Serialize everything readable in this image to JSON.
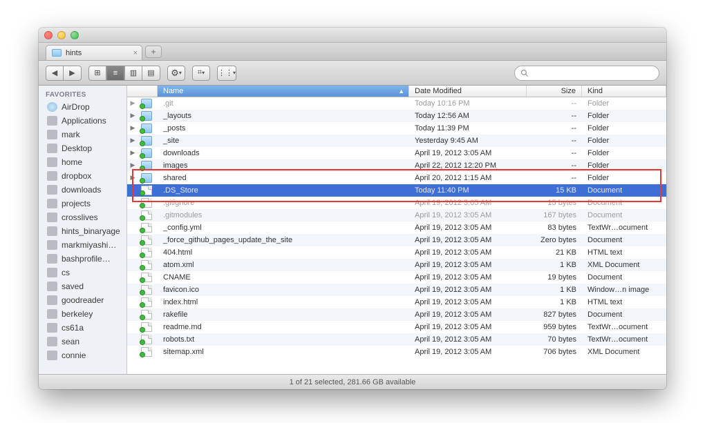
{
  "window": {
    "tab_title": "hints"
  },
  "toolbar": {
    "search_placeholder": ""
  },
  "sidebar": {
    "heading": "FAVORITES",
    "items": [
      {
        "label": "AirDrop",
        "icon": "airdrop"
      },
      {
        "label": "Applications",
        "icon": "apps"
      },
      {
        "label": "mark",
        "icon": "home"
      },
      {
        "label": "Desktop",
        "icon": "desktop"
      },
      {
        "label": "home",
        "icon": "folder"
      },
      {
        "label": "dropbox",
        "icon": "folder"
      },
      {
        "label": "downloads",
        "icon": "folder"
      },
      {
        "label": "projects",
        "icon": "folder"
      },
      {
        "label": "crosslives",
        "icon": "folder"
      },
      {
        "label": "hints_binaryage",
        "icon": "folder"
      },
      {
        "label": "markmiyashi…",
        "icon": "folder"
      },
      {
        "label": "bashprofile…",
        "icon": "folder"
      },
      {
        "label": "cs",
        "icon": "folder"
      },
      {
        "label": "saved",
        "icon": "folder"
      },
      {
        "label": "goodreader",
        "icon": "folder"
      },
      {
        "label": "berkeley",
        "icon": "folder"
      },
      {
        "label": "cs61a",
        "icon": "folder"
      },
      {
        "label": "sean",
        "icon": "folder"
      },
      {
        "label": "connie",
        "icon": "folder"
      }
    ]
  },
  "columns": {
    "name": "Name",
    "date": "Date Modified",
    "size": "Size",
    "kind": "Kind"
  },
  "files": [
    {
      "name": ".git",
      "date": "Today 10:16 PM",
      "size": "--",
      "kind": "Folder",
      "type": "folder",
      "expandable": true,
      "dim": true
    },
    {
      "name": "_layouts",
      "date": "Today 12:56 AM",
      "size": "--",
      "kind": "Folder",
      "type": "folder",
      "expandable": true
    },
    {
      "name": "_posts",
      "date": "Today 11:39 PM",
      "size": "--",
      "kind": "Folder",
      "type": "folder",
      "expandable": true
    },
    {
      "name": "_site",
      "date": "Yesterday 9:45 AM",
      "size": "--",
      "kind": "Folder",
      "type": "folder",
      "expandable": true
    },
    {
      "name": "downloads",
      "date": "April 19, 2012 3:05 AM",
      "size": "--",
      "kind": "Folder",
      "type": "folder",
      "expandable": true
    },
    {
      "name": "images",
      "date": "April 22, 2012 12:20 PM",
      "size": "--",
      "kind": "Folder",
      "type": "folder",
      "expandable": true
    },
    {
      "name": "shared",
      "date": "April 20, 2012 1:15 AM",
      "size": "--",
      "kind": "Folder",
      "type": "folder",
      "expandable": true
    },
    {
      "name": ".DS_Store",
      "date": "Today 11:40 PM",
      "size": "15 KB",
      "kind": "Document",
      "type": "doc",
      "dim": true,
      "selected": true
    },
    {
      "name": ".gitignore",
      "date": "April 19, 2012 3:05 AM",
      "size": "15 bytes",
      "kind": "Document",
      "type": "doc",
      "dim": true
    },
    {
      "name": ".gitmodules",
      "date": "April 19, 2012 3:05 AM",
      "size": "167 bytes",
      "kind": "Document",
      "type": "doc",
      "dim": true
    },
    {
      "name": "_config.yml",
      "date": "April 19, 2012 3:05 AM",
      "size": "83 bytes",
      "kind": "TextWr…ocument",
      "type": "doc"
    },
    {
      "name": "_force_github_pages_update_the_site",
      "date": "April 19, 2012 3:05 AM",
      "size": "Zero bytes",
      "kind": "Document",
      "type": "doc"
    },
    {
      "name": "404.html",
      "date": "April 19, 2012 3:05 AM",
      "size": "21 KB",
      "kind": "HTML text",
      "type": "doc"
    },
    {
      "name": "atom.xml",
      "date": "April 19, 2012 3:05 AM",
      "size": "1 KB",
      "kind": "XML Document",
      "type": "doc"
    },
    {
      "name": "CNAME",
      "date": "April 19, 2012 3:05 AM",
      "size": "19 bytes",
      "kind": "Document",
      "type": "doc"
    },
    {
      "name": "favicon.ico",
      "date": "April 19, 2012 3:05 AM",
      "size": "1 KB",
      "kind": "Window…n image",
      "type": "doc"
    },
    {
      "name": "index.html",
      "date": "April 19, 2012 3:05 AM",
      "size": "1 KB",
      "kind": "HTML text",
      "type": "doc"
    },
    {
      "name": "rakefile",
      "date": "April 19, 2012 3:05 AM",
      "size": "827 bytes",
      "kind": "Document",
      "type": "doc"
    },
    {
      "name": "readme.md",
      "date": "April 19, 2012 3:05 AM",
      "size": "959 bytes",
      "kind": "TextWr…ocument",
      "type": "doc"
    },
    {
      "name": "robots.txt",
      "date": "April 19, 2012 3:05 AM",
      "size": "70 bytes",
      "kind": "TextWr…ocument",
      "type": "doc"
    },
    {
      "name": "sitemap.xml",
      "date": "April 19, 2012 3:05 AM",
      "size": "706 bytes",
      "kind": "XML Document",
      "type": "doc"
    }
  ],
  "status": "1 of 21 selected, 281.66 GB available",
  "highlight_rows": [
    6,
    8
  ]
}
